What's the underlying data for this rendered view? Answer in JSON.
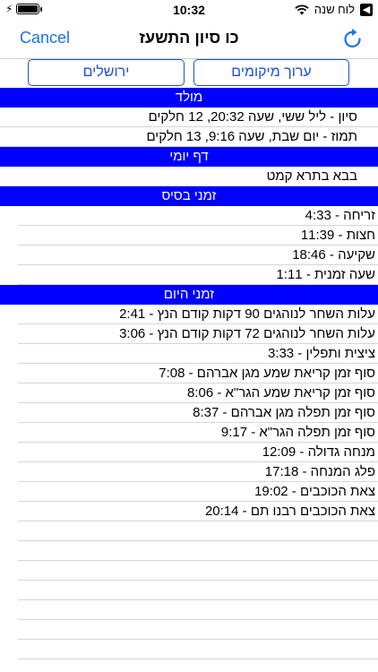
{
  "status_bar": {
    "time": "10:32",
    "app_label": "לוח שנה",
    "back_glyph": "◀",
    "charging_glyph": "⚡"
  },
  "nav": {
    "cancel_label": "Cancel",
    "title": "כו סיון התשעז",
    "accent_color": "#1a73e8"
  },
  "buttons": {
    "edit_locations": "ערוך מיקומים",
    "city": "ירושלים",
    "border_color": "#1a4fd6"
  },
  "sections": [
    {
      "title": "מולד",
      "rows": [
        "סיון - ליל ששי, שעה 20:32, 12 חלקים",
        "תמוז - יום שבת, שעה 9:16, 13 חלקים"
      ]
    },
    {
      "title": "דף יומי",
      "rows": [
        "בבא בתרא קמט"
      ]
    },
    {
      "title": "זמני בסיס",
      "rows": [
        "זריחה - 4:33",
        "חצות - 11:39",
        "שקיעה - 18:46",
        "שעה זמנית - 1:11"
      ]
    },
    {
      "title": "זמני היום",
      "rows": [
        "עלות השחר לנוהגים 90 דקות קודם הנץ - 2:41",
        "עלות השחר לנוהגים 72 דקות קודם הנץ - 3:06",
        "ציצית ותפלין - 3:33",
        "סוף זמן קריאת שמע מגן אברהם - 7:08",
        "סוף זמן קריאת שמע הגר\"א - 8:06",
        "סוף זמן תפלה מגן אברהם - 8:37",
        "סוף זמן תפלה הגר\"א - 9:17",
        "מנחה גדולה - 12:09",
        "פלג המנחה - 17:18",
        "צאת הכוכבים - 19:02",
        "צאת הכוכבים רבנו תם - 20:14"
      ]
    }
  ],
  "section_header_color": "#0000ff"
}
